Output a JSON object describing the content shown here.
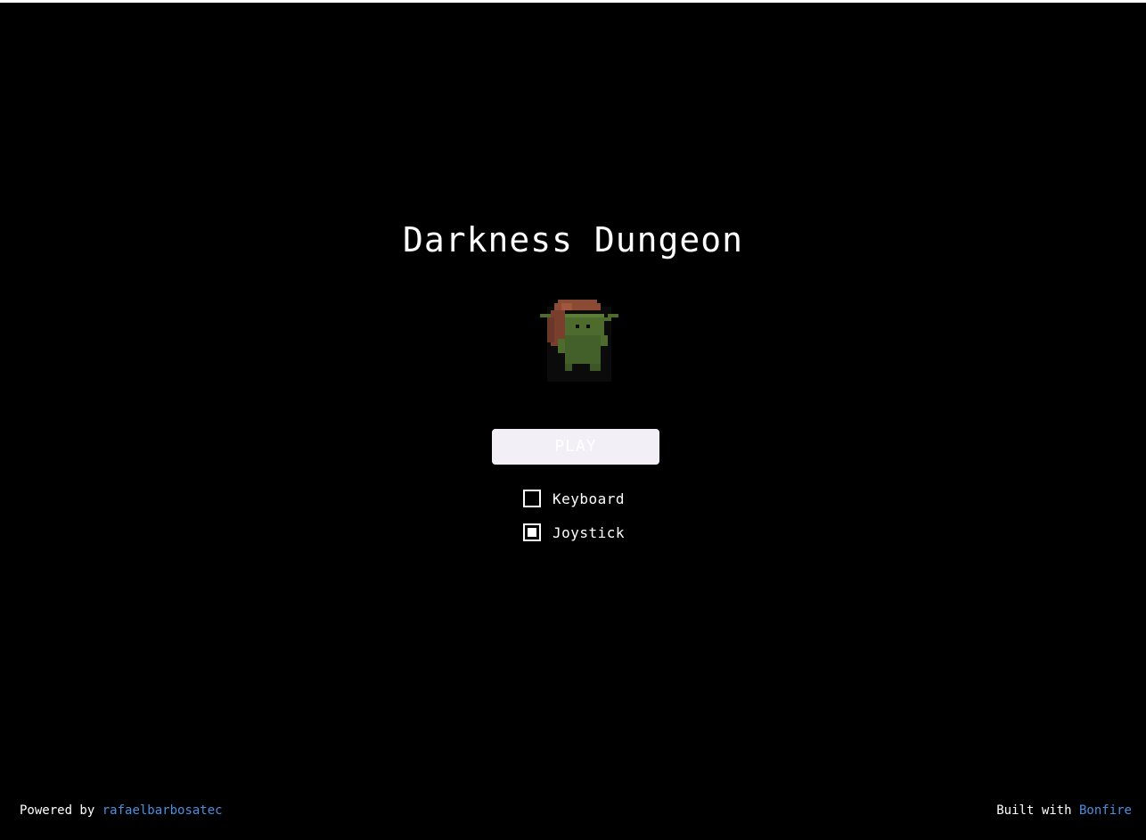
{
  "game": {
    "title": "Darkness Dungeon"
  },
  "menu": {
    "play_label": "PLAY",
    "options": [
      {
        "label": "Keyboard",
        "checked": false
      },
      {
        "label": "Joystick",
        "checked": true
      }
    ]
  },
  "footer": {
    "powered_prefix": "Powered by",
    "powered_link": "rafaelbarbosatec",
    "built_prefix": "Built with",
    "built_link": "Bonfire"
  },
  "colors": {
    "background": "#000000",
    "text": "#ffffff",
    "link": "#4a90e2",
    "play_button": "#f3eff7"
  }
}
